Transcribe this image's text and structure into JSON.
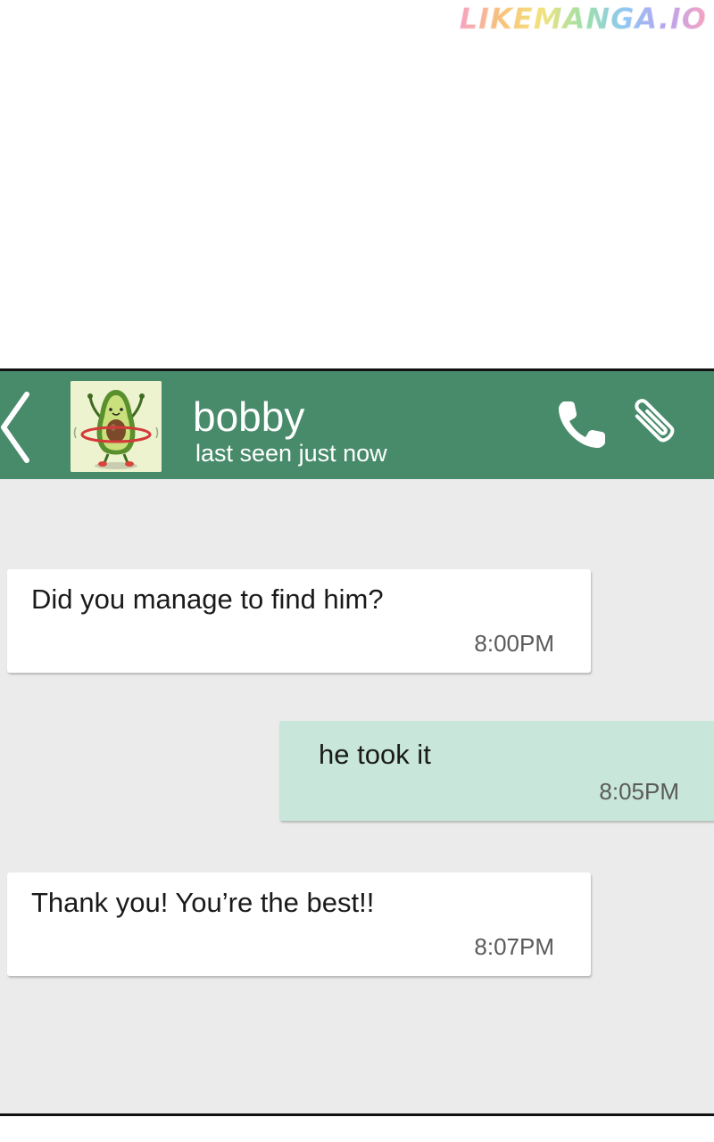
{
  "watermark": "LIKEMANGA.IO",
  "header": {
    "contact_name": "bobby",
    "status": "last seen just now",
    "background_color": "#488b6b"
  },
  "icons": {
    "back": "chevron-left-icon",
    "avatar": "avocado-hula-hoop-avatar",
    "call": "phone-icon",
    "attach": "paperclip-icon"
  },
  "messages": [
    {
      "direction": "incoming",
      "text": "Did you manage to find him?",
      "time": "8:00PM"
    },
    {
      "direction": "outgoing",
      "text": "he took it",
      "time": "8:05PM"
    },
    {
      "direction": "incoming",
      "text": "Thank you! You’re the best!!",
      "time": "8:07PM"
    }
  ],
  "colors": {
    "chat_background": "#ebebeb",
    "incoming_bubble": "#ffffff",
    "outgoing_bubble": "#c8e6da"
  }
}
